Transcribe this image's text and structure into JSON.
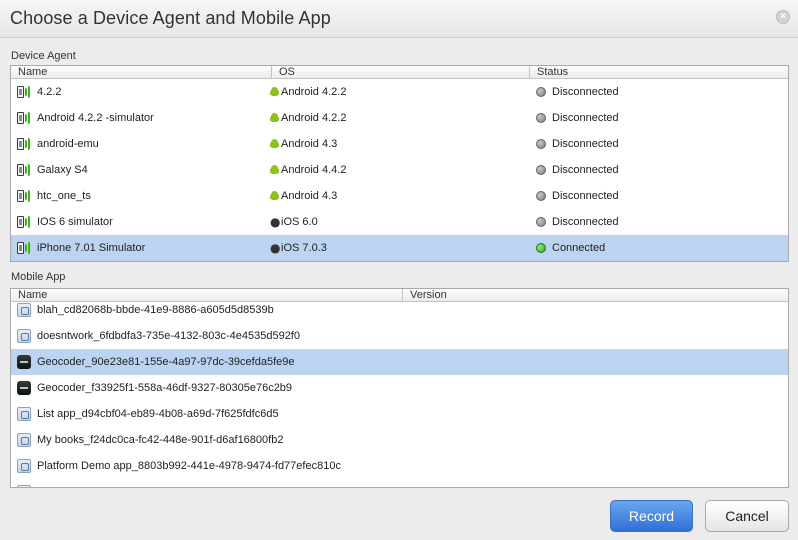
{
  "window": {
    "title": "Choose a Device Agent and Mobile App",
    "close_glyph": "×"
  },
  "device_agent": {
    "label": "Device Agent",
    "columns": {
      "name": "Name",
      "os": "OS",
      "status": "Status"
    },
    "rows": [
      {
        "name": "4.2.2",
        "os_icon": "android-icon",
        "os": "Android 4.2.2",
        "status": "Disconnected",
        "connected": false,
        "selected": false
      },
      {
        "name": "Android 4.2.2 -simulator",
        "os_icon": "android-icon",
        "os": "Android 4.2.2",
        "status": "Disconnected",
        "connected": false,
        "selected": false
      },
      {
        "name": "android-emu",
        "os_icon": "android-icon",
        "os": "Android 4.3",
        "status": "Disconnected",
        "connected": false,
        "selected": false
      },
      {
        "name": "Galaxy S4",
        "os_icon": "android-icon",
        "os": "Android 4.4.2",
        "status": "Disconnected",
        "connected": false,
        "selected": false
      },
      {
        "name": "htc_one_ts",
        "os_icon": "android-icon",
        "os": "Android 4.3",
        "status": "Disconnected",
        "connected": false,
        "selected": false
      },
      {
        "name": "IOS 6 simulator",
        "os_icon": "apple-icon",
        "os": "iOS 6.0",
        "status": "Disconnected",
        "connected": false,
        "selected": false
      },
      {
        "name": "iPhone 7.01 Simulator",
        "os_icon": "apple-icon",
        "os": "iOS 7.0.3",
        "status": "Connected",
        "connected": true,
        "selected": true
      }
    ]
  },
  "mobile_app": {
    "label": "Mobile App",
    "columns": {
      "name": "Name",
      "version": "Version"
    },
    "rows": [
      {
        "name": "blah_cd82068b-bbde-41e9-8886-a605d5d8539b",
        "icon": "generic-app-icon",
        "selected": false,
        "clipped_top": true
      },
      {
        "name": "doesntwork_6fdbdfa3-735e-4132-803c-4e4535d592f0",
        "icon": "generic-app-icon",
        "selected": false
      },
      {
        "name": "Geocoder_90e23e81-155e-4a97-97dc-39cefda5fe9e",
        "icon": "geocoder-app-icon",
        "selected": true
      },
      {
        "name": "Geocoder_f33925f1-558a-46df-9327-80305e76c2b9",
        "icon": "geocoder-app-icon",
        "selected": false
      },
      {
        "name": "List app_d94cbf04-eb89-4b08-a69d-7f625fdfc6d5",
        "icon": "generic-app-icon",
        "selected": false
      },
      {
        "name": "My books_f24dc0ca-fc42-448e-901f-d6af16800fb2",
        "icon": "generic-app-icon",
        "selected": false
      },
      {
        "name": "Platform Demo app_8803b992-441e-4978-9474-fd77efec810c",
        "icon": "generic-app-icon",
        "selected": false
      }
    ]
  },
  "buttons": {
    "record": "Record",
    "cancel": "Cancel"
  },
  "colors": {
    "selection": "#bcd4f2",
    "connected": "#2d9c1a",
    "disconnected": "#7a7a7a",
    "primary": "#2f6fd6"
  }
}
